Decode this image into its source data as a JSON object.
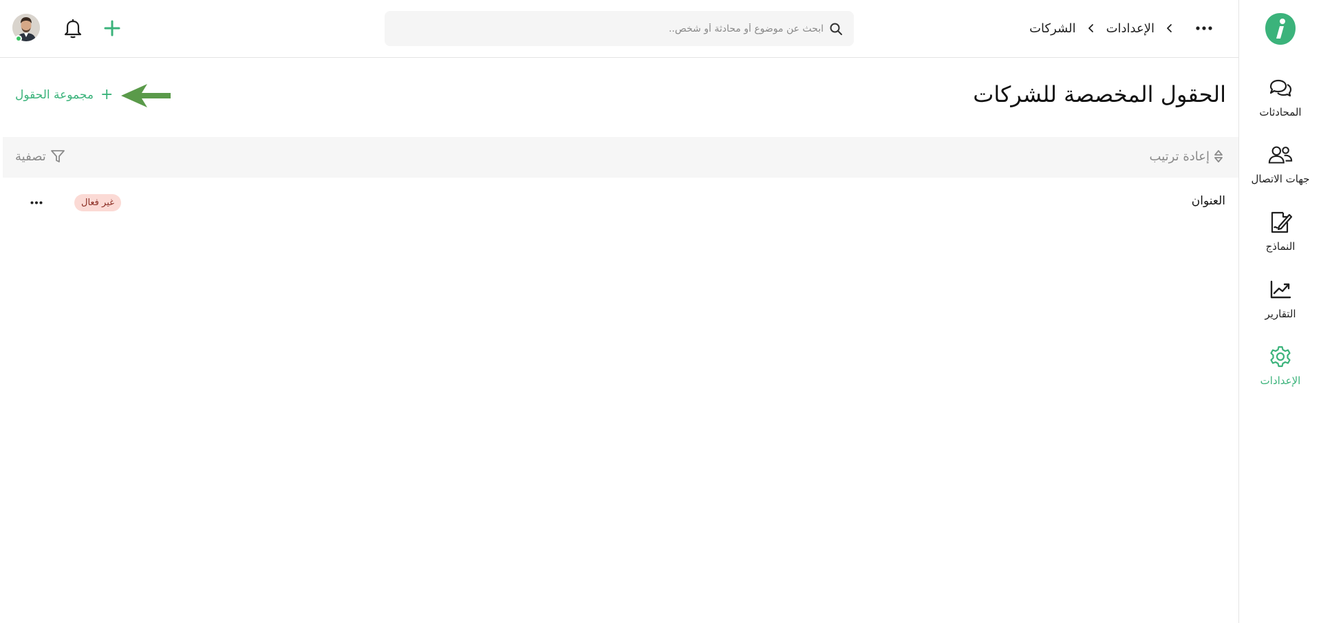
{
  "sidebar": {
    "logo": "intercom-style-logo",
    "items": [
      {
        "label": "المحادثات",
        "icon": "chat-bubbles-icon"
      },
      {
        "label": "جهات الاتصال",
        "icon": "contacts-icon"
      },
      {
        "label": "النماذج",
        "icon": "forms-edit-icon"
      },
      {
        "label": "التقارير",
        "icon": "reports-chart-icon"
      },
      {
        "label": "الإعدادات",
        "icon": "settings-gear-icon",
        "active": true
      }
    ]
  },
  "topbar": {
    "breadcrumb": [
      "الإعدادات",
      "الشركات"
    ],
    "search_placeholder": "ابحث عن موضوع أو محادثة أو شخص.."
  },
  "main": {
    "title": "الحقول المخصصة للشركات",
    "add_group_label": "مجموعة الحقول",
    "toolbar": {
      "reorder_label": "إعادة ترتيب",
      "filter_label": "تصفية"
    },
    "fields": [
      {
        "name": "العنوان",
        "status": "غير فعال"
      }
    ]
  },
  "colors": {
    "accent": "#3bb37b",
    "badge_bg": "#fbdad5",
    "badge_text": "#8b2e24",
    "arrow": "#5a9a4a"
  }
}
